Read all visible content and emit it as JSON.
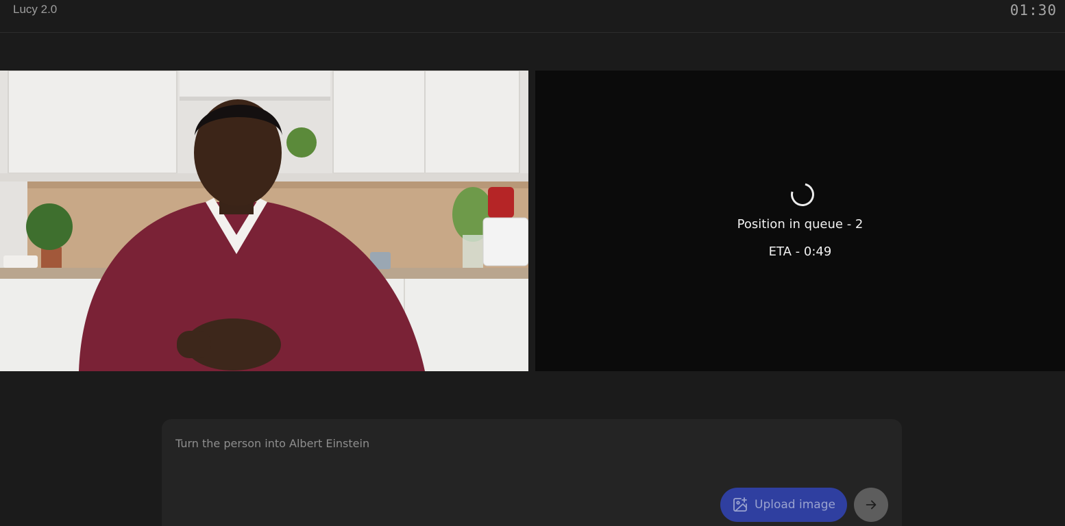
{
  "header": {
    "app_title": "Lucy 2.0",
    "timer": "01:30"
  },
  "output": {
    "queue_position": "Position in queue - 2",
    "eta": "ETA - 0:49"
  },
  "composer": {
    "prompt_placeholder": "Turn the person into Albert Einstein",
    "prompt_value": "",
    "upload_label": "Upload image"
  },
  "icons": {
    "upload": "image-add-icon",
    "send": "arrow-right-icon",
    "loading": "spinner-icon"
  },
  "colors": {
    "background": "#1b1b1b",
    "panel": "#0b0b0b",
    "composer": "#242424",
    "upload_button": "#2f3fa0",
    "send_button": "#5d5d5d"
  }
}
